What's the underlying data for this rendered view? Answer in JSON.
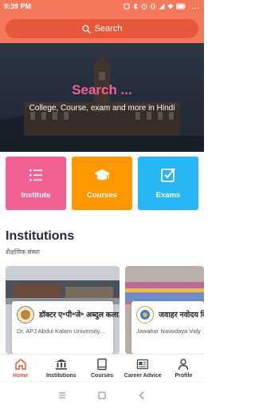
{
  "status_bar": {
    "time": "9:39 PM",
    "more": "..."
  },
  "search": {
    "label": "Search"
  },
  "hero": {
    "title": "Search ...",
    "subtitle": "College, Course, exam and more in Hindi"
  },
  "categories": [
    {
      "label": "Institute",
      "color": "#f06292",
      "icon": "list-icon"
    },
    {
      "label": "Courses",
      "color": "#ff9800",
      "icon": "graduation-cap-icon"
    },
    {
      "label": "Exams",
      "color": "#29b6f6",
      "icon": "checkbox-icon"
    }
  ],
  "section": {
    "title": "Institutions",
    "subtitle": "शैक्षणिक संस्था"
  },
  "institutions": [
    {
      "name_hindi": "डॉक्टर ए॰पी॰जे॰ अब्दुल कला...",
      "name_english": "Dr. APJ Abdul Kalam University,..."
    },
    {
      "name_hindi": "जवाहर नवोदय विद्याल",
      "name_english": "Jawahar Navodaya Vidy"
    }
  ],
  "bottom_nav": [
    {
      "label": "Home",
      "icon": "home-icon",
      "active": true
    },
    {
      "label": "Institutions",
      "icon": "institution-icon",
      "active": false
    },
    {
      "label": "Courses",
      "icon": "book-icon",
      "active": false
    },
    {
      "label": "Career Advice",
      "icon": "newspaper-icon",
      "active": false
    },
    {
      "label": "Profile",
      "icon": "person-icon",
      "active": false
    }
  ],
  "colors": {
    "accent": "#f4785a",
    "search_bg": "#e8573a",
    "hero_title": "#f06292",
    "active_nav": "#e8573a"
  }
}
